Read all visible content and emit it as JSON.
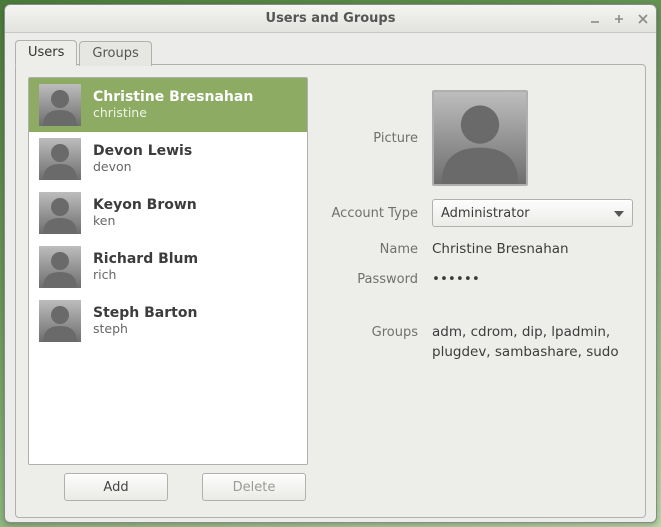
{
  "window": {
    "title": "Users and Groups"
  },
  "tabs": {
    "users": "Users",
    "groups": "Groups"
  },
  "users": [
    {
      "fullname": "Christine Bresnahan",
      "username": "christine"
    },
    {
      "fullname": "Devon Lewis",
      "username": "devon"
    },
    {
      "fullname": "Keyon Brown",
      "username": "ken"
    },
    {
      "fullname": "Richard Blum",
      "username": "rich"
    },
    {
      "fullname": "Steph Barton",
      "username": "steph"
    }
  ],
  "labels": {
    "picture": "Picture",
    "account_type": "Account Type",
    "name": "Name",
    "password": "Password",
    "groups": "Groups"
  },
  "detail": {
    "name": "Christine Bresnahan",
    "account_type": "Administrator",
    "password": "••••••",
    "groups": "adm, cdrom, dip, lpadmin, plugdev, sambashare, sudo"
  },
  "buttons": {
    "add": "Add",
    "delete": "Delete"
  }
}
